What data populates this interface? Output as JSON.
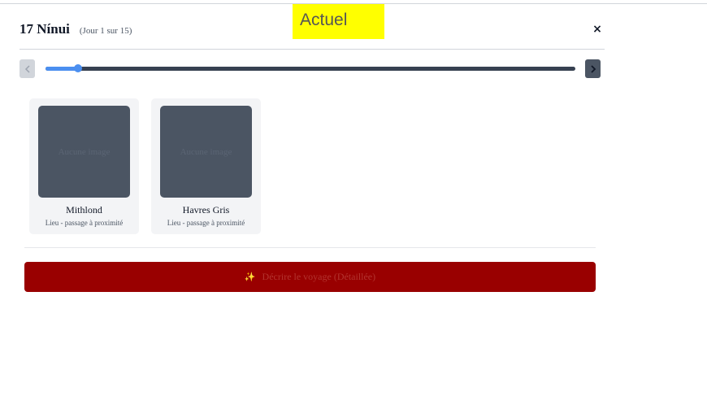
{
  "badge": {
    "label": "Actuel"
  },
  "header": {
    "day": "17 Nínui",
    "sub": "(Jour 1 sur 15)",
    "close": "×"
  },
  "timeline": {
    "prev_icon": "chevron-left-icon",
    "next_icon": "chevron-right-icon",
    "current_day": 1,
    "total_days": 15,
    "accent": "#4b8ff0"
  },
  "cards": [
    {
      "image_placeholder": "Aucune image",
      "name": "Mithlond",
      "sub": "Lieu - passage à proximité"
    },
    {
      "image_placeholder": "Aucune image",
      "name": "Havres Gris",
      "sub": "Lieu - passage à proximité"
    }
  ],
  "action": {
    "icon": "✨",
    "label": "Décrire le voyage (Détaillée)",
    "color": "#990000"
  }
}
